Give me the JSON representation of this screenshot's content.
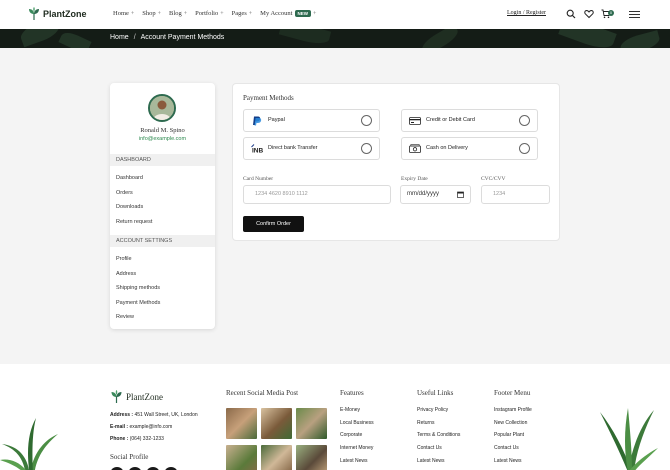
{
  "header": {
    "brand": "PlantZone",
    "nav": [
      {
        "label": "Home",
        "has_plus": true
      },
      {
        "label": "Shop",
        "has_plus": true
      },
      {
        "label": "Blog",
        "has_plus": true
      },
      {
        "label": "Portfolio",
        "has_plus": true
      },
      {
        "label": "Pages",
        "has_plus": true
      },
      {
        "label": "My Account",
        "has_plus": true,
        "badge": "NEW"
      }
    ],
    "login_label": "Login / Register",
    "cart_count": "0",
    "icons": [
      "search-icon",
      "heart-icon",
      "cart-icon",
      "menu-icon"
    ]
  },
  "breadcrumb": {
    "home": "Home",
    "separator": "/",
    "current": "Account Payment Methods"
  },
  "sidebar": {
    "name": "Ronald M. Spino",
    "email": "info@example.com",
    "section1": "DASHBOARD",
    "items1": [
      "Dashboard",
      "Orders",
      "Downloads",
      "Return request"
    ],
    "section2": "ACCOUNT SETTINGS",
    "items2": [
      "Profile",
      "Address",
      "Shipping methods",
      "Payment Methods",
      "Review"
    ]
  },
  "payment": {
    "title": "Payment Methods",
    "options": [
      {
        "label": "Paypal",
        "icon": "paypal-icon"
      },
      {
        "label": "Credit or Debit Card",
        "icon": "credit-card-icon"
      },
      {
        "label": "Direct bank Transfer",
        "icon": "bank-icon"
      },
      {
        "label": "Cash on Delivery",
        "icon": "cash-icon"
      }
    ],
    "card_number_label": "Card Number",
    "card_number_placeholder": "1234 4620 8910 1112",
    "expiry_label": "Expiry Date",
    "expiry_placeholder": "mm/dd/yyyy",
    "cvc_label": "CVC/CVV",
    "cvc_placeholder": "1234",
    "confirm_label": "Confirm Order"
  },
  "footer": {
    "brand": "PlantZone",
    "address_label": "Address :",
    "address": "451 Wall Street, UK, London",
    "email_label": "E-mail :",
    "email": "example@info.com",
    "phone_label": "Phone :",
    "phone": "(064) 332-1233",
    "social_title": "Social Profile",
    "social_heading": "Recent Social Media Post",
    "features_heading": "Features",
    "features": [
      "E-Money",
      "Local Business",
      "Corporate",
      "Internet Money",
      "Latest News"
    ],
    "useful_heading": "Useful Links",
    "useful": [
      "Privacy Policy",
      "Returns",
      "Terms & Conditions",
      "Contact Us",
      "Latest News"
    ],
    "menu_heading": "Footer Menu",
    "menu": [
      "Instagram Profile",
      "New Collection",
      "Popular Plant",
      "Contact Us",
      "Latest News"
    ]
  },
  "colors": {
    "accent": "#2d6a4f",
    "banner": "#141c16",
    "button": "#111111"
  }
}
